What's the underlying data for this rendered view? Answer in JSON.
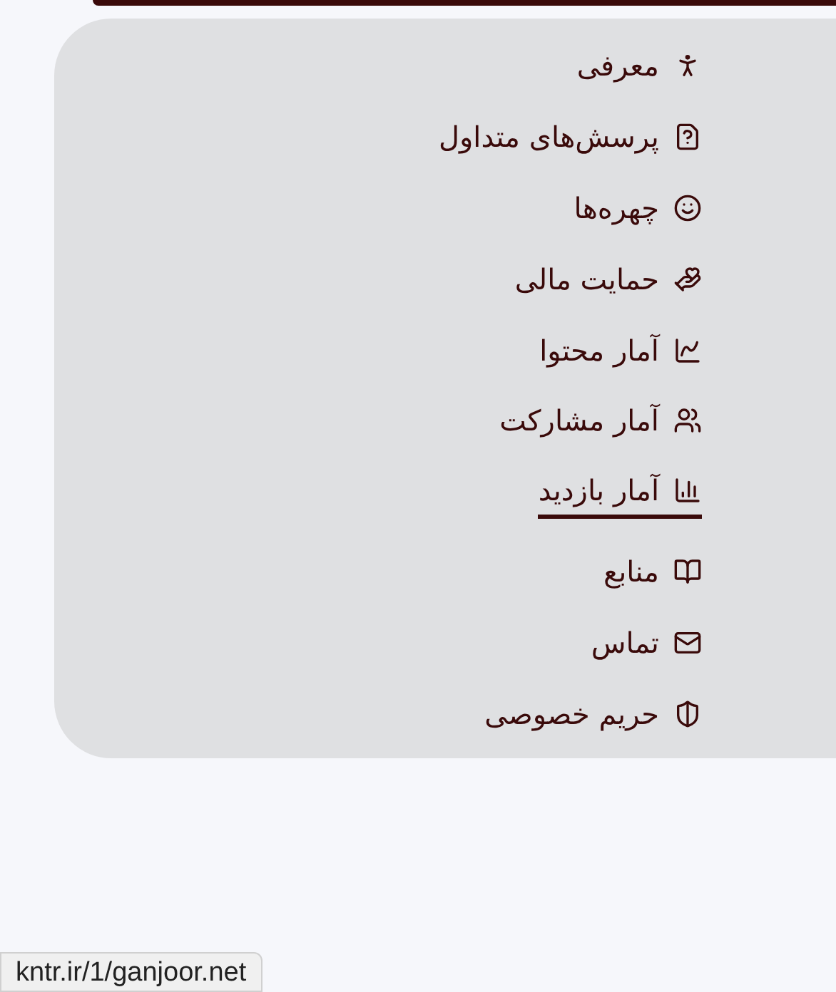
{
  "menu": {
    "items": [
      {
        "label": "معرفی",
        "selected": false
      },
      {
        "label": "پرسش‌های متداول",
        "selected": false
      },
      {
        "label": "چهره‌ها",
        "selected": false
      },
      {
        "label": "حمایت مالی",
        "selected": false
      },
      {
        "label": "آمار محتوا",
        "selected": false
      },
      {
        "label": "آمار مشارکت",
        "selected": false
      },
      {
        "label": "آمار بازدید",
        "selected": true
      },
      {
        "label": "منابع",
        "selected": false
      },
      {
        "label": "تماس",
        "selected": false
      },
      {
        "label": "حریم خصوصی",
        "selected": false
      }
    ]
  },
  "status_bar": {
    "url": "kntr.ir/1/ganjoor.net"
  }
}
